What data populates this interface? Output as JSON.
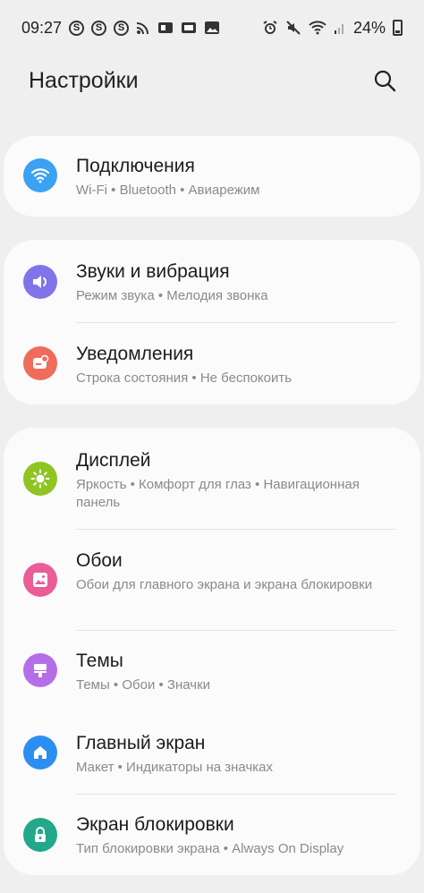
{
  "status": {
    "time": "09:27",
    "battery": "24%"
  },
  "header": {
    "title": "Настройки"
  },
  "items": [
    {
      "title": "Подключения",
      "sub": "Wi-Fi  •  Bluetooth  •  Авиарежим",
      "icon": "wifi-icon",
      "color": "#3aa1f3"
    },
    {
      "title": "Звуки и вибрация",
      "sub": "Режим звука  •  Мелодия звонка",
      "icon": "volume-icon",
      "color": "#8074eb"
    },
    {
      "title": "Уведомления",
      "sub": "Строка состояния  •  Не беспокоить",
      "icon": "notification-icon",
      "color": "#ef6c5c"
    },
    {
      "title": "Дисплей",
      "sub": "Яркость  •  Комфорт для глаз  •  Навигационная панель",
      "icon": "brightness-icon",
      "color": "#8fc423"
    },
    {
      "title": "Обои",
      "sub": "Обои для главного экрана и экрана блокировки",
      "icon": "wallpaper-icon",
      "color": "#ea5d96"
    },
    {
      "title": "Темы",
      "sub": "Темы  •  Обои  •  Значки",
      "icon": "theme-brush-icon",
      "color": "#b46ee8"
    },
    {
      "title": "Главный экран",
      "sub": "Макет  •  Индикаторы на значках",
      "icon": "home-icon",
      "color": "#2c8ef0"
    },
    {
      "title": "Экран блокировки",
      "sub": "Тип блокировки экрана  •  Always On Display",
      "icon": "lock-icon",
      "color": "#23a88a"
    }
  ]
}
